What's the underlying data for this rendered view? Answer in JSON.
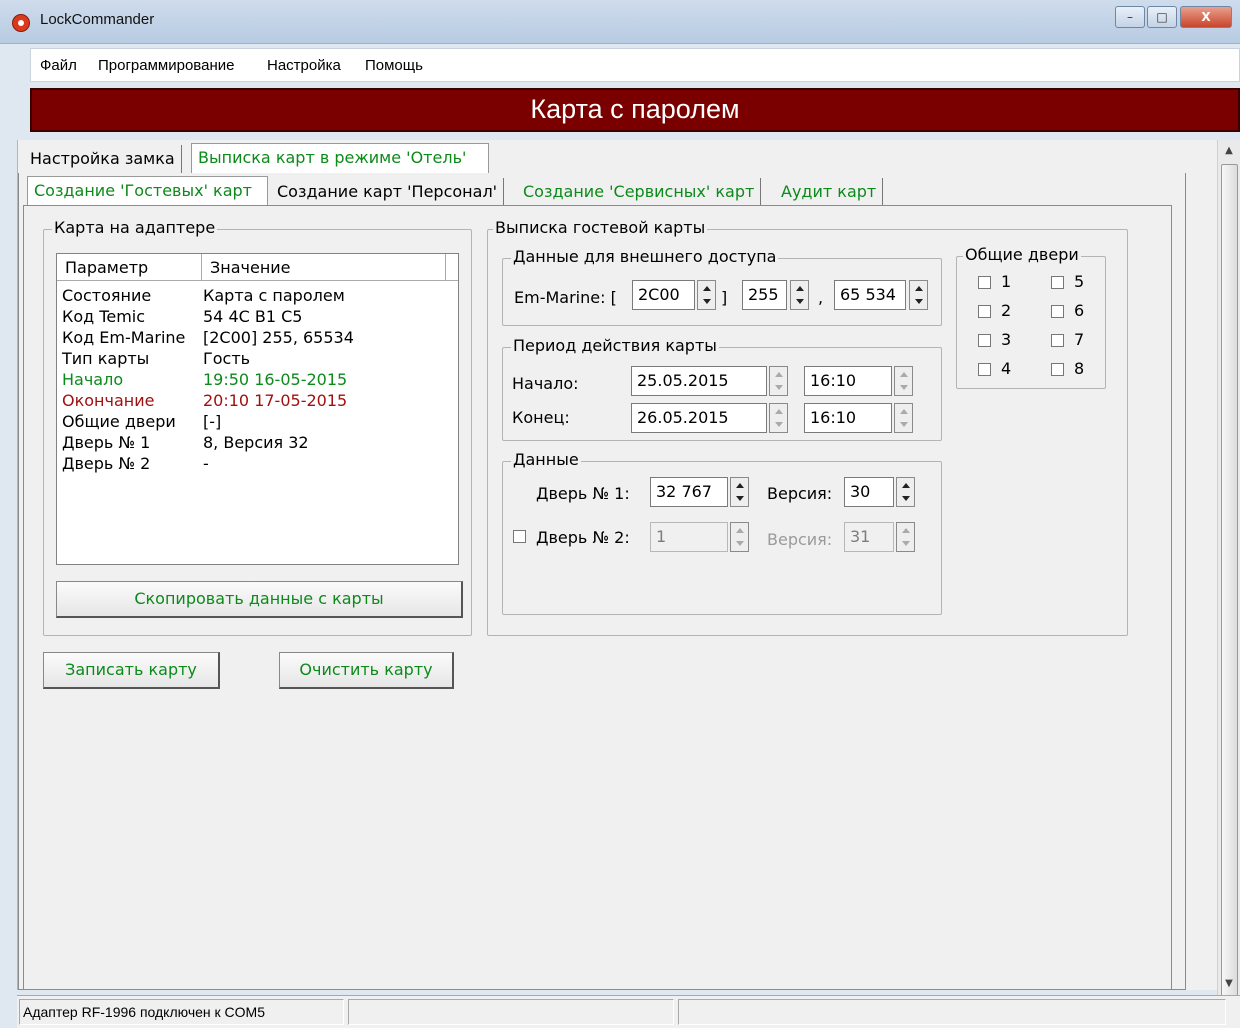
{
  "window": {
    "title": "LockCommander",
    "icon": "app-icon",
    "minimize": "–",
    "maximize": "□",
    "close": "X"
  },
  "menu": [
    "Файл",
    "Программирование",
    "Настройка",
    "Помощь"
  ],
  "header": {
    "title": "Карта с паролем",
    "bg_color": "#7a0000"
  },
  "top_tabs": [
    {
      "label": "Настройка замка",
      "active": false
    },
    {
      "label": "Выписка карт в режиме 'Отель'",
      "active": true
    }
  ],
  "sub_tabs": [
    {
      "label": "Создание 'Гостевых' карт",
      "active": true
    },
    {
      "label": "Создание карт 'Персонал'",
      "active": false
    },
    {
      "label": "Создание 'Сервисных' карт",
      "active": false
    },
    {
      "label": "Аудит карт",
      "active": false
    }
  ],
  "card_on_adapter": {
    "group_label": "Карта на адаптере",
    "columns": [
      "Параметр",
      "Значение"
    ],
    "rows": [
      {
        "param": "Состояние",
        "value": "Карта с паролем",
        "color": "#000000"
      },
      {
        "param": "Код Temic",
        "value": "54 4C B1 C5",
        "color": "#000000"
      },
      {
        "param": "Код Em-Marine",
        "value": "[2C00] 255, 65534",
        "color": "#000000"
      },
      {
        "param": "Тип карты",
        "value": "Гость",
        "color": "#000000"
      },
      {
        "param": "Начало",
        "value": "19:50 16-05-2015",
        "color": "#0c8a1a"
      },
      {
        "param": "Окончание",
        "value": "20:10 17-05-2015",
        "color": "#a01010"
      },
      {
        "param": "Общие двери",
        "value": "[-]",
        "color": "#000000"
      },
      {
        "param": "Дверь № 1",
        "value": "8, Версия 32",
        "color": "#000000"
      },
      {
        "param": "Дверь № 2",
        "value": "-",
        "color": "#000000"
      }
    ],
    "copy_button": "Скопировать данные с карты"
  },
  "guest_card": {
    "group_label": "Выписка гостевой карты",
    "external": {
      "label": "Данные для внешнего доступа",
      "em_marine_label": "Em-Marine: [",
      "bracket_close": "]",
      "comma": ",",
      "code": "2C00",
      "val1": "255",
      "val2": "65 534"
    },
    "period": {
      "label": "Период действия карты",
      "start_label": "Начало:",
      "end_label": "Конец:",
      "start_date": "25.05.2015",
      "start_time": "16:10",
      "end_date": "26.05.2015",
      "end_time": "16:10"
    },
    "data": {
      "label": "Данные",
      "door1_label": "Дверь № 1:",
      "door1_value": "32 767",
      "version_label": "Версия:",
      "version1": "30",
      "door2_label": "Дверь № 2:",
      "door2_checked": false,
      "door2_value": "1",
      "version2_label": "Версия:",
      "version2": "31"
    },
    "common_doors": {
      "label": "Общие двери",
      "doors": [
        "1",
        "2",
        "3",
        "4",
        "5",
        "6",
        "7",
        "8"
      ]
    }
  },
  "buttons": {
    "write": "Записать карту",
    "clear": "Очистить карту"
  },
  "status": {
    "text": "Адаптер RF-1996 подключен к COM5"
  }
}
